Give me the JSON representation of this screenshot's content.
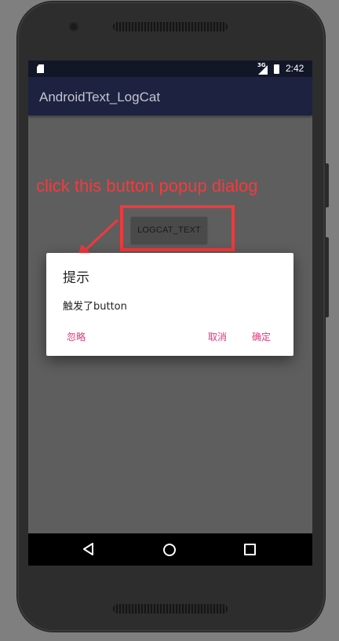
{
  "status_bar": {
    "network": "3G",
    "time": "2:42",
    "icons": [
      "sd-card-icon",
      "signal-icon",
      "battery-icon"
    ]
  },
  "app_bar": {
    "title": "AndroidText_LogCat"
  },
  "annotation": {
    "text": "click this button popup dialog",
    "color": "#f23b3f"
  },
  "main": {
    "logcat_button_label": "LOGCAT_TEXT"
  },
  "dialog": {
    "title": "提示",
    "message": "触发了button",
    "buttons": {
      "ignore": "忽略",
      "cancel": "取消",
      "ok": "确定"
    },
    "button_color": "#e6337e"
  },
  "nav_bar": {
    "icons": [
      "back-icon",
      "home-icon",
      "recents-icon"
    ]
  }
}
